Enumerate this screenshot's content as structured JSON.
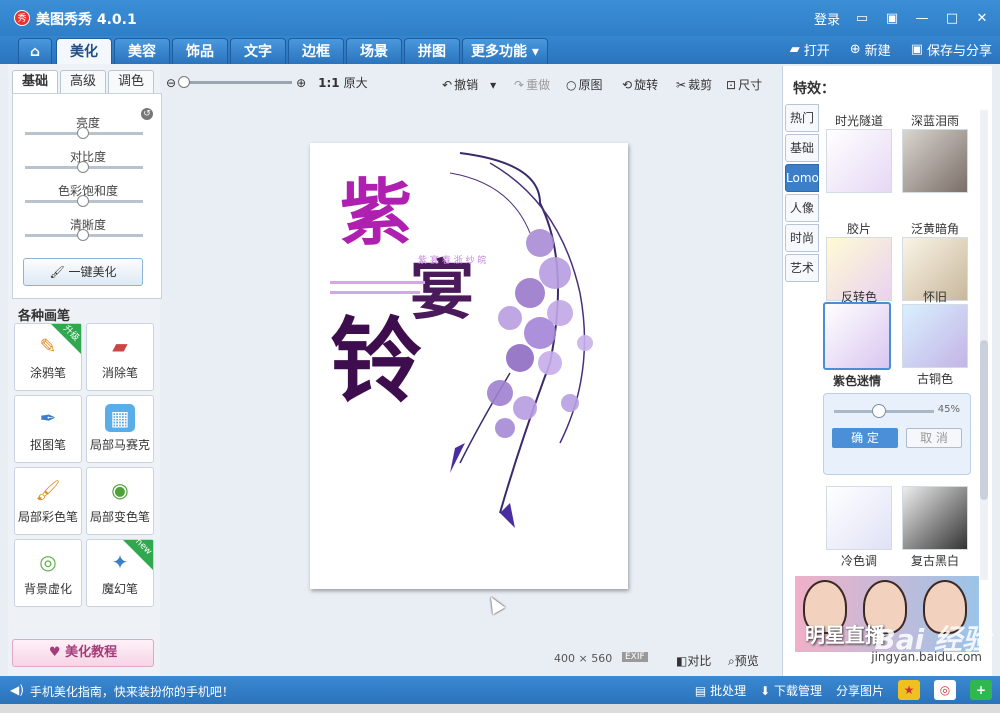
{
  "window": {
    "title": "美图秀秀 4.0.1",
    "logo_text": "秀",
    "login": "登录",
    "controls": [
      "message-icon",
      "skin-icon",
      "minimize-icon",
      "maximize-icon",
      "close-icon"
    ]
  },
  "nav": {
    "tabs": [
      "美化",
      "美容",
      "饰品",
      "文字",
      "边框",
      "场景",
      "拼图",
      "更多功能"
    ],
    "active": "美化",
    "actions": {
      "open": "打开",
      "new": "新建",
      "save": "保存与分享"
    }
  },
  "left": {
    "subtabs": [
      "基础",
      "高级",
      "调色"
    ],
    "sliders": [
      {
        "label": "亮度",
        "value": 0.5
      },
      {
        "label": "对比度",
        "value": 0.5
      },
      {
        "label": "色彩饱和度",
        "value": 0.5
      },
      {
        "label": "清晰度",
        "value": 0.5
      }
    ],
    "onekey": "一键美化",
    "brushes_title": "各种画笔",
    "brushes": [
      {
        "label": "涂鸦笔",
        "badge": "升级"
      },
      {
        "label": "消除笔",
        "badge": ""
      },
      {
        "label": "抠图笔",
        "badge": ""
      },
      {
        "label": "局部马赛克",
        "badge": ""
      },
      {
        "label": "局部彩色笔",
        "badge": ""
      },
      {
        "label": "局部变色笔",
        "badge": ""
      },
      {
        "label": "背景虚化",
        "badge": ""
      },
      {
        "label": "魔幻笔",
        "badge": "new"
      }
    ],
    "tutorial": "美化教程"
  },
  "toolbar": {
    "ratio": "1:1",
    "original_size": "原大",
    "undo": "撤销",
    "redo": "重做",
    "original": "原图",
    "rotate": "旋转",
    "crop": "裁剪",
    "size": "尺寸"
  },
  "canvas": {
    "poster_title_1": "紫",
    "poster_title_2": "宴",
    "poster_title_3": "铃",
    "poster_subtitle": "紫 宴 春 浙 纱 皖",
    "dim_w": "400",
    "dim_x": "×",
    "dim_h": "560",
    "exif": "EXIF",
    "compare": "对比",
    "preview": "预览"
  },
  "right": {
    "title": "特效：",
    "categories": [
      "热门",
      "基础",
      "Lomo",
      "人像",
      "时尚",
      "艺术"
    ],
    "active_category": "Lomo",
    "effects": [
      "时光隧道",
      "深蓝泪雨",
      "胶片",
      "泛黄暗角",
      "反转色",
      "怀旧",
      "紫色迷情",
      "古铜色",
      "冷色调",
      "复古黑白"
    ],
    "selected_effect": "紫色迷情",
    "intensity": "45%",
    "confirm": "确 定",
    "cancel": "取 消",
    "ad_text": "明星直播"
  },
  "bottom": {
    "tip": "手机美化指南，快来装扮你的手机吧！",
    "batch": "批处理",
    "download": "下载管理",
    "share": "分享图片"
  },
  "watermark": {
    "text": "Bai 经验",
    "url": "jingyan.baidu.com"
  },
  "colors": {
    "brand_blue": "#2f7fc8",
    "accent_purple": "#a428c8",
    "poster_dark": "#3e0d4e"
  }
}
